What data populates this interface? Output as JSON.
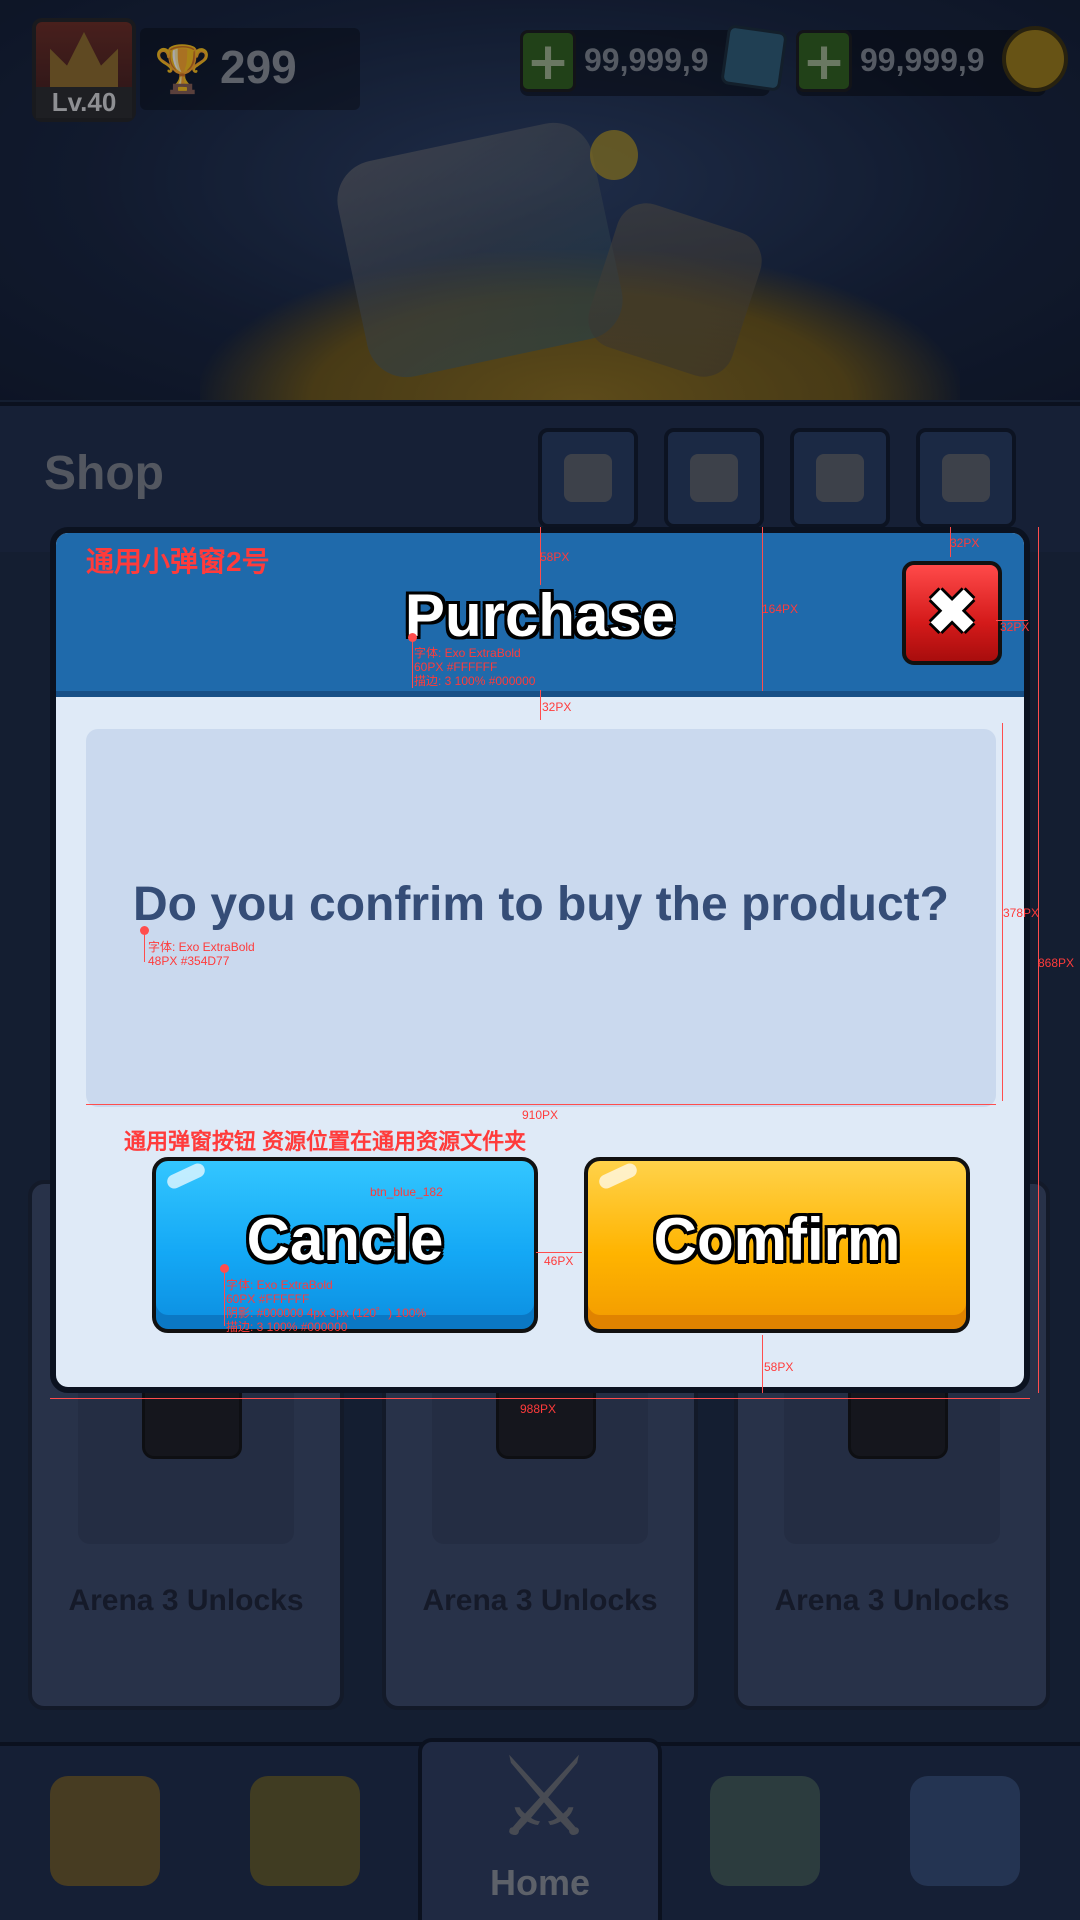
{
  "top_bar": {
    "level": "Lv.40",
    "trophies": "299",
    "gems": "99,999,9",
    "coins": "99,999,9"
  },
  "shop": {
    "title": "Shop",
    "tabs": [
      "gift-icon",
      "cards-icon",
      "chest-icon",
      "money-bag-icon"
    ]
  },
  "arena_cards": [
    "Arena 3 Unlocks",
    "Arena 3 Unlocks",
    "Arena 3 Unlocks"
  ],
  "bottom_nav": {
    "home_label": "Home",
    "items": [
      "treasure-chest-icon",
      "card-book-icon",
      "crossed-swords-icon",
      "map-icon",
      "guild-icon"
    ]
  },
  "popup": {
    "title": "Purchase",
    "message": "Do you confrim to buy the product?",
    "close_symbol": "✖",
    "cancel_label": "Cancle",
    "confirm_label": "Comfirm"
  },
  "annotations": {
    "popup_name": "通用小弹窗2号",
    "button_note": "通用弹窗按钮 资源位置在通用资源文件夹",
    "title_font": [
      "字体: Exo ExtraBold",
      "60PX #FFFFFF",
      "描边: 3 100% #000000"
    ],
    "message_font": [
      "字体: Exo ExtraBold",
      "48PX #354D77"
    ],
    "button_font": [
      "字体: Exo ExtraBold",
      "60PX #FFFFFF",
      "阴影: #000000 4px 3px (120゜) 100%",
      "描边: 3 100% #000000"
    ],
    "btn_asset": "btn_blue_182",
    "dims": {
      "header_top": "58PX",
      "header_height": "164PX",
      "close_top": "32PX",
      "close_right": "32PX",
      "panel_gap": "32PX",
      "panel_height": "378PX",
      "panel_width": "910PX",
      "popup_height": "868PX",
      "btn_gap": "46PX",
      "bottom_margin": "58PX",
      "popup_width": "988PX"
    }
  },
  "colors": {
    "header": "#1F6AAB",
    "message": "#354D77",
    "cancel": "#14A8F5",
    "confirm": "#FFB400",
    "close": "#D41A1A"
  }
}
